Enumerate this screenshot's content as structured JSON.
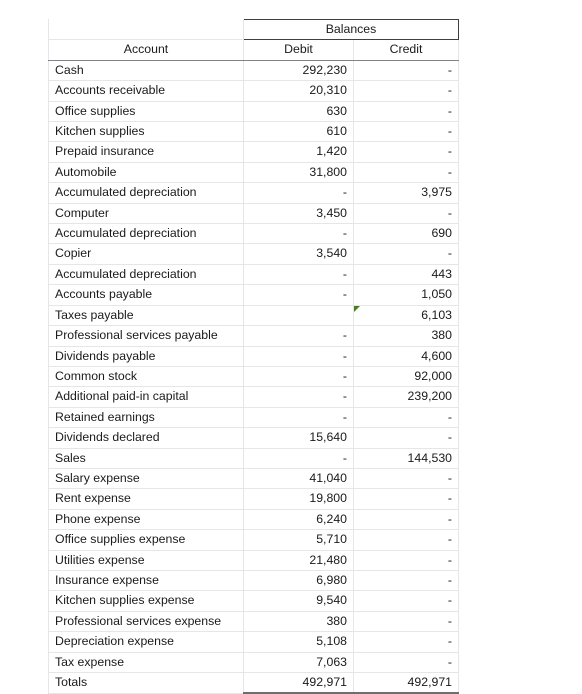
{
  "sheet": {
    "group_header": "Balances",
    "columns": [
      "Account",
      "Debit",
      "Credit"
    ],
    "dash": "-",
    "error_flag": "error-flag-triangle",
    "accent_flag_color": "#4a7b2b",
    "grid_color": "#e4e6e8",
    "rule_color": "#3f3f41"
  },
  "rows": [
    {
      "account": "Cash",
      "debit": "292,230",
      "credit": "-"
    },
    {
      "account": "Accounts receivable",
      "debit": "20,310",
      "credit": "-"
    },
    {
      "account": "Office supplies",
      "debit": "630",
      "credit": "-"
    },
    {
      "account": "Kitchen supplies",
      "debit": "610",
      "credit": "-"
    },
    {
      "account": "Prepaid insurance",
      "debit": "1,420",
      "credit": "-"
    },
    {
      "account": "Automobile",
      "debit": "31,800",
      "credit": "-"
    },
    {
      "account": "Accumulated depreciation",
      "debit": "-",
      "credit": "3,975"
    },
    {
      "account": "Computer",
      "debit": "3,450",
      "credit": "-"
    },
    {
      "account": "Accumulated depreciation",
      "debit": "-",
      "credit": "690"
    },
    {
      "account": "Copier",
      "debit": "3,540",
      "credit": "-"
    },
    {
      "account": "Accumulated depreciation",
      "debit": "-",
      "credit": "443"
    },
    {
      "account": "Accounts payable",
      "debit": "-",
      "credit": "1,050"
    },
    {
      "account": "Taxes payable",
      "debit": "",
      "credit": "6,103",
      "flag": true
    },
    {
      "account": "Professional services payable",
      "debit": "-",
      "credit": "380"
    },
    {
      "account": "Dividends payable",
      "debit": "-",
      "credit": "4,600"
    },
    {
      "account": "Common stock",
      "debit": "-",
      "credit": "92,000"
    },
    {
      "account": "Additional paid-in capital",
      "debit": "-",
      "credit": "239,200"
    },
    {
      "account": "Retained earnings",
      "debit": "-",
      "credit": "-"
    },
    {
      "account": "Dividends declared",
      "debit": "15,640",
      "credit": "-"
    },
    {
      "account": "Sales",
      "debit": "-",
      "credit": "144,530"
    },
    {
      "account": "Salary expense",
      "debit": "41,040",
      "credit": "-"
    },
    {
      "account": "Rent expense",
      "debit": "19,800",
      "credit": "-"
    },
    {
      "account": "Phone expense",
      "debit": "6,240",
      "credit": "-"
    },
    {
      "account": "Office supplies expense",
      "debit": "5,710",
      "credit": "-"
    },
    {
      "account": "Utilities expense",
      "debit": "21,480",
      "credit": "-"
    },
    {
      "account": "Insurance expense",
      "debit": "6,980",
      "credit": "-"
    },
    {
      "account": "Kitchen supplies expense",
      "debit": "9,540",
      "credit": "-"
    },
    {
      "account": "Professional services expense",
      "debit": "380",
      "credit": "-"
    },
    {
      "account": "Depreciation expense",
      "debit": "5,108",
      "credit": "-"
    },
    {
      "account": "Tax expense",
      "debit": "7,063",
      "credit": "-"
    }
  ],
  "totals": {
    "account": "Totals",
    "debit": "492,971",
    "credit": "492,971"
  }
}
